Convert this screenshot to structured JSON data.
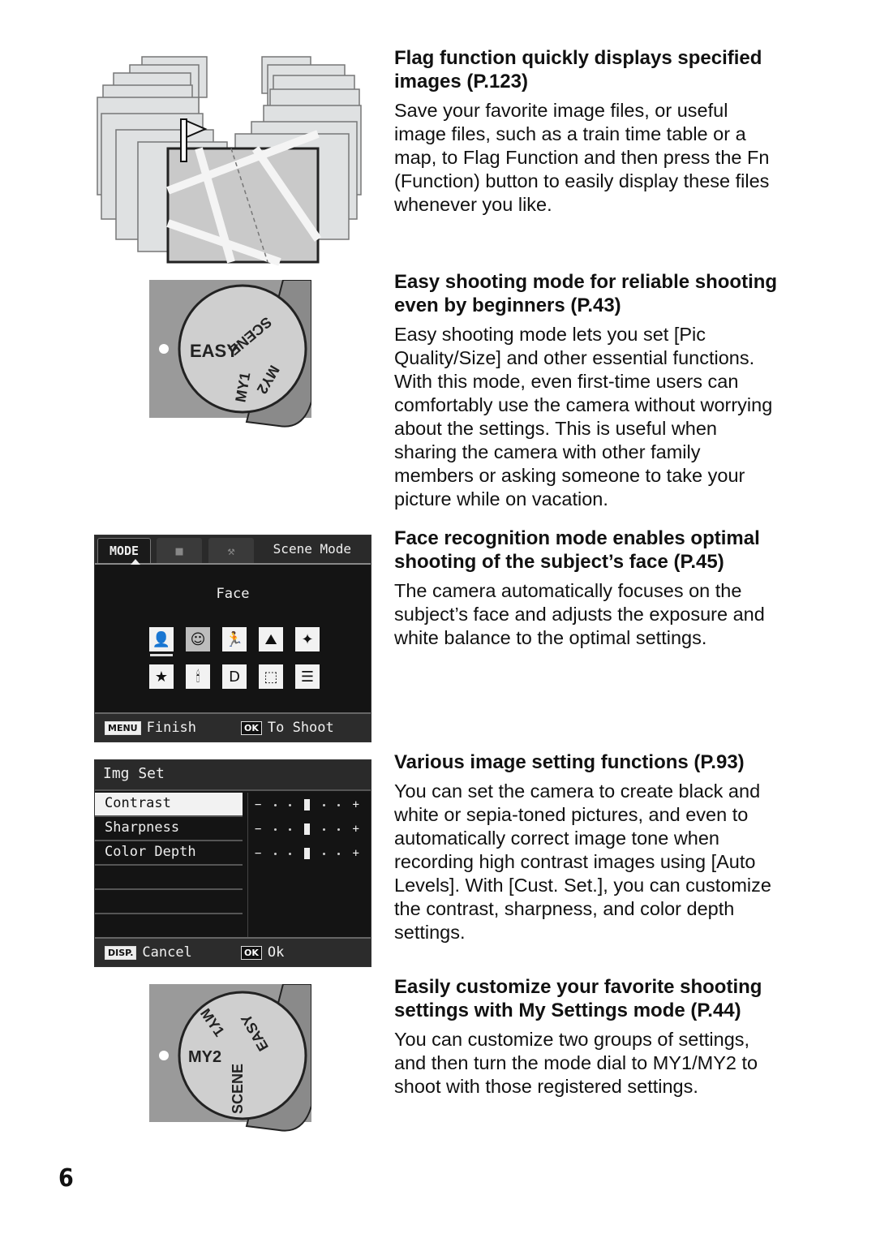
{
  "page_number": "6",
  "sections": [
    {
      "title": "Flag function quickly displays specified images (P.123)",
      "body": "Save your favorite image files, or useful image files, such as a train time table or a map, to Flag Function and then press the Fn (Function) button to easily display these files whenever you like."
    },
    {
      "title": "Easy shooting mode for reliable shooting even by beginners (P.43)",
      "body": "Easy shooting mode lets you set [Pic Quality/Size] and other essential functions. With this mode, even first-time users can comfortably use the camera without worrying about the settings. This is useful when sharing the camera with other family members or asking someone to take your picture while on vacation."
    },
    {
      "title": "Face recognition mode enables optimal shooting of the subject’s face (P.45)",
      "body": "The camera automatically focuses on the subject’s face and adjusts the exposure and white balance to the optimal settings."
    },
    {
      "title": "Various image setting functions (P.93)",
      "body": "You can set the camera to create black and white or sepia-toned pictures, and even to automatically correct image tone when recording high contrast images using [Auto Levels]. With [Cust. Set.], you can customize the contrast, sharpness, and color depth settings."
    },
    {
      "title": "Easily customize your favorite shooting settings with My Settings mode (P.44)",
      "body": "You can customize two groups of settings, and then turn the mode dial to MY1/MY2 to shoot with those registered settings."
    }
  ],
  "dial1": {
    "labels": [
      "EASY",
      "SCENE",
      "MY1",
      "MY2"
    ]
  },
  "dial2": {
    "labels": [
      "MY1",
      "MY2",
      "EASY",
      "SCENE"
    ]
  },
  "scene_screen": {
    "tab_mode": "MODE",
    "scene_label": "Scene Mode",
    "selected_mode": "Face",
    "icons": [
      "portrait",
      "face",
      "sports",
      "landscape",
      "night-landscape",
      "night-portrait",
      "candlelight",
      "skew-correct",
      "text",
      "zoom-macro"
    ],
    "icon_glyphs": [
      "👤",
      "☺",
      "🏃",
      "⛰",
      "✦",
      "★",
      "🕯",
      "D",
      "⬚",
      "☰"
    ],
    "footer_left_key": "MENU",
    "footer_left_label": "Finish",
    "footer_right_key": "OK",
    "footer_right_label": "To Shoot"
  },
  "img_set_screen": {
    "title": "Img Set",
    "rows": [
      {
        "label": "Contrast",
        "level": 0
      },
      {
        "label": "Sharpness",
        "level": 0
      },
      {
        "label": "Color Depth",
        "level": 0
      }
    ],
    "minus": "−",
    "plus": "+",
    "footer_left_key": "DISP.",
    "footer_left_label": "Cancel",
    "footer_right_key": "OK",
    "footer_right_label": "Ok"
  }
}
